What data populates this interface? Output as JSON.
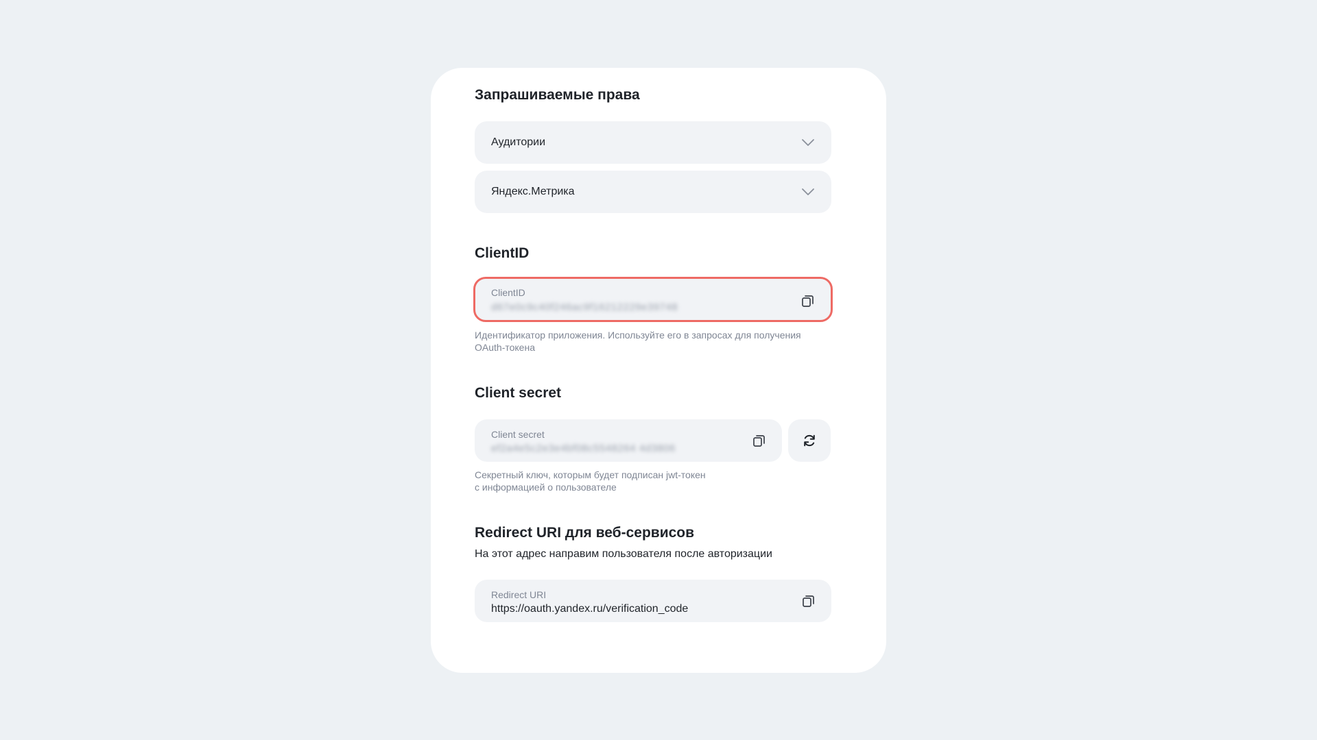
{
  "permissions": {
    "title": "Запрашиваемые права",
    "items": [
      {
        "label": "Аудитории"
      },
      {
        "label": "Яндекс.Метрика"
      }
    ]
  },
  "client_id": {
    "title": "ClientID",
    "field_label": "ClientID",
    "value": "d67e0c9c40f246ac9f16212229e39748",
    "hint": "Идентификатор приложения. Используйте его в запросах для получения OAuth-токена"
  },
  "client_secret": {
    "title": "Client secret",
    "field_label": "Client secret",
    "value": "ef2a4e5c2e3e4bf08c5548264 4d3806",
    "hint_line1": "Секретный ключ, которым будет подписан jwt-токен",
    "hint_line2": "с информацией о пользователе"
  },
  "redirect": {
    "title": "Redirect URI для веб-сервисов",
    "description": "На этот адрес направим пользователя после авторизации",
    "field_label": "Redirect URI",
    "value": "https://oauth.yandex.ru/verification_code"
  },
  "colors": {
    "page_bg": "#edf1f4",
    "card_bg": "#ffffff",
    "field_bg": "#f1f3f6",
    "highlight": "#ee6a64",
    "muted_text": "#7f8694"
  },
  "icons": {
    "copy": "copy-icon",
    "refresh": "refresh-icon",
    "chevron": "chevron-down-icon"
  }
}
